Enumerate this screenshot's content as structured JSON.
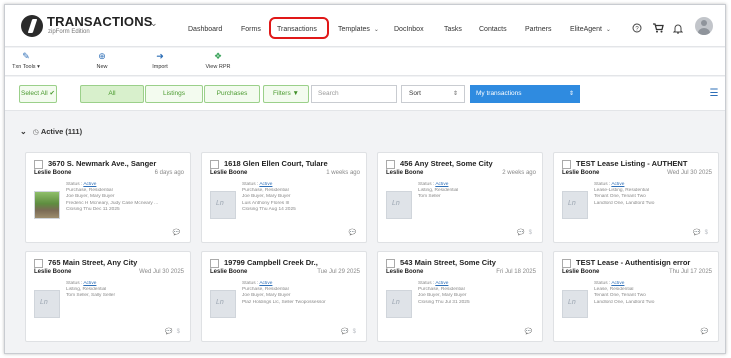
{
  "app": {
    "logo_title": "TRANSACTIONS",
    "logo_subtitle": "zipForm Edition",
    "logo_caret": "⌄"
  },
  "nav": {
    "items": [
      {
        "label": "Dashboard"
      },
      {
        "label": "Forms"
      },
      {
        "label": "Transactions",
        "highlighted": true
      },
      {
        "label": "Templates",
        "caret": "⌄"
      },
      {
        "label": "DocInbox"
      },
      {
        "label": "Tasks"
      },
      {
        "label": "Contacts"
      },
      {
        "label": "Partners"
      },
      {
        "label": "EliteAgent",
        "caret": "⌄"
      }
    ],
    "icons": {
      "help": "⑦",
      "cart": "▀",
      "bell": "♫"
    }
  },
  "toolbar": {
    "tools": [
      {
        "label": "Txn Tools ▾",
        "icon": "wrench-icon",
        "glyph": "✎"
      },
      {
        "label": "New",
        "icon": "plus-circle-icon",
        "glyph": "⊕"
      },
      {
        "label": "Import",
        "icon": "import-icon",
        "glyph": "➜"
      },
      {
        "label": "View RPR",
        "icon": "rpr-icon",
        "glyph": "❖"
      }
    ]
  },
  "filters": {
    "select_all": "Select All ✔",
    "tabs": [
      {
        "label": "All",
        "active": true
      },
      {
        "label": "Listings",
        "active": false
      },
      {
        "label": "Purchases",
        "active": false
      }
    ],
    "filters_label": "Filters",
    "search_placeholder": "Search",
    "sort_label": "Sort",
    "view_label": "My transactions"
  },
  "section": {
    "title": "Active (111)"
  },
  "cards": [
    {
      "title": "3670 S. Newmark Ave., Sanger",
      "agent": "Leslie Boone",
      "when": "6 days ago",
      "status_label": "Status :",
      "status": "Active",
      "lines": [
        "Purchase, Residential",
        "Joe Buyer, Mary Buyer",
        "Frederic H Mcneary, Judy Case Mcneary ...",
        "Closing Thu Dec 11 2025"
      ],
      "photo": true,
      "icons": [
        "💬"
      ]
    },
    {
      "title": "1618 Glen Ellen Court, Tulare",
      "agent": "Leslie Boone",
      "when": "1 weeks ago",
      "status_label": "Status :",
      "status": "Active",
      "lines": [
        "Purchase, Residential",
        "Joe Buyer, Mary Buyer",
        "Luis Anthony Flores III",
        "Closing Thu Aug 14 2025"
      ],
      "photo": false,
      "icons": [
        "💬"
      ]
    },
    {
      "title": "456 Any Street, Some City",
      "agent": "Leslie Boone",
      "when": "2 weeks ago",
      "status_label": "Status :",
      "status": "Active",
      "lines": [
        "Listing, Residential",
        "Tom Seller"
      ],
      "photo": false,
      "icons": [
        "💬",
        "$"
      ]
    },
    {
      "title": "TEST Lease Listing - AUTHENT",
      "agent": "Leslie Boone",
      "when": "Wed Jul 30 2025",
      "status_label": "Status :",
      "status": "Active",
      "lines": [
        "Lease-Listing, Residential",
        "Tenant One, Tenant Two",
        "Landlord One, Landlord Two"
      ],
      "photo": false,
      "icons": [
        "💬",
        "$"
      ]
    },
    {
      "title": "765 Main Street, Any City",
      "agent": "Leslie Boone",
      "when": "Wed Jul 30 2025",
      "status_label": "Status :",
      "status": "Active",
      "lines": [
        "Listing, Residential",
        "Tom Seller, Sally Seller"
      ],
      "photo": false,
      "icons": [
        "💬",
        "$"
      ]
    },
    {
      "title": "19799 Campbell Creek Dr.,",
      "agent": "Leslie Boone",
      "when": "Tue Jul 29 2025",
      "status_label": "Status :",
      "status": "Active",
      "lines": [
        "Purchase, Residential",
        "Joe Buyer, Mary Buyer",
        "Plaz Holdings Llc, Seller Twopossessor",
        ""
      ],
      "photo": false,
      "icons": [
        "💬",
        "$"
      ]
    },
    {
      "title": "543 Main Street, Some City",
      "agent": "Leslie Boone",
      "when": "Fri Jul 18 2025",
      "status_label": "Status :",
      "status": "Active",
      "lines": [
        "Purchase, Residential",
        "Joe Buyer, Mary Buyer",
        "Closing Thu Jul 31 2025"
      ],
      "photo": false,
      "icons": [
        "💬"
      ]
    },
    {
      "title": "TEST Lease - Authentisign error",
      "agent": "Leslie Boone",
      "when": "Thu Jul 17 2025",
      "status_label": "Status :",
      "status": "Active",
      "lines": [
        "Lease, Residential",
        "Tenant One, Tenant Two",
        "Landlord One, Landlord Two"
      ],
      "photo": false,
      "icons": [
        "💬"
      ]
    }
  ],
  "colors": {
    "highlight": "#e01818",
    "accent": "#2f8be0",
    "filter_green": "#4a9a2f"
  }
}
